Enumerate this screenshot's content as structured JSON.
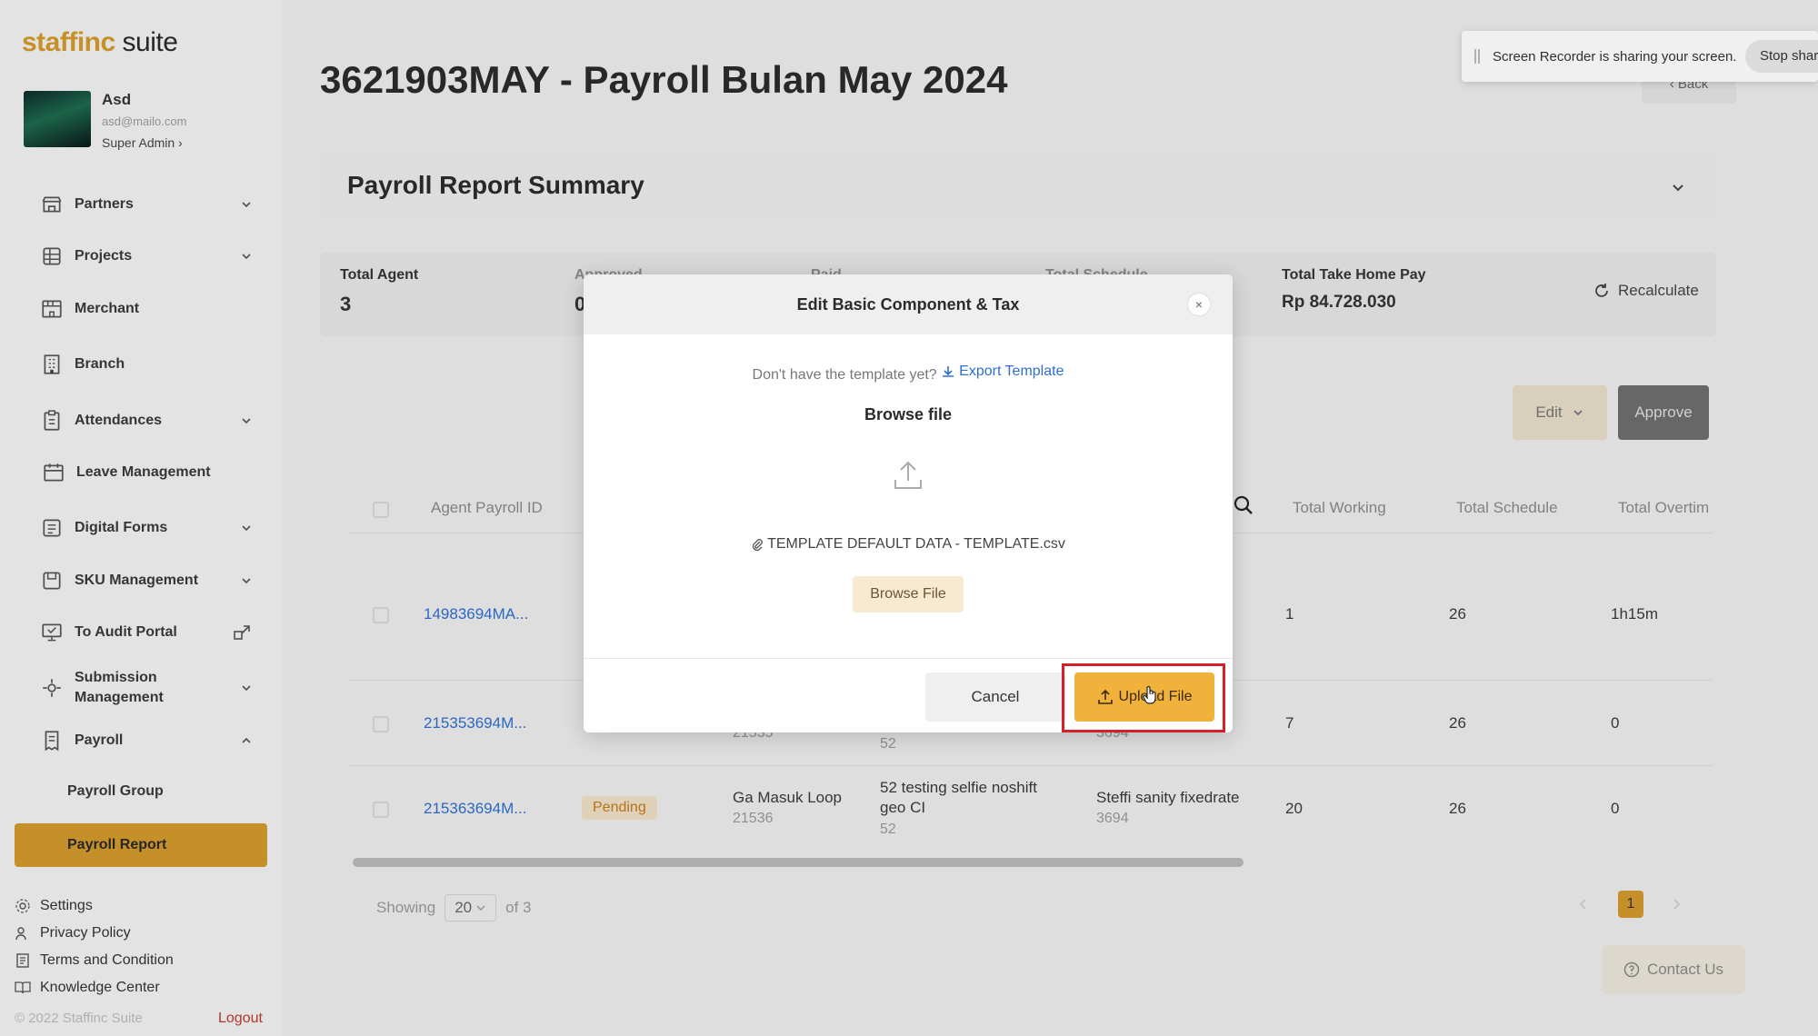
{
  "sidebar": {
    "logo_a": "staff",
    "logo_b": "inc",
    "logo_c": " suite",
    "user": {
      "name": "Asd",
      "email": "asd@mailo.com",
      "role": "Super Admin ›"
    },
    "items": [
      {
        "label": "Partners",
        "icon": "store-icon"
      },
      {
        "label": "Projects",
        "icon": "grid-icon"
      },
      {
        "label": "Merchant",
        "icon": "shop-icon"
      },
      {
        "label": "Branch",
        "icon": "building-icon"
      },
      {
        "label": "Attendances",
        "icon": "clipboard-icon"
      },
      {
        "label": "Leave Management",
        "icon": "calendar-icon"
      },
      {
        "label": "Digital Forms",
        "icon": "form-icon"
      },
      {
        "label": "SKU Management",
        "icon": "box-icon"
      },
      {
        "label": "To Audit Portal",
        "icon": "monitor-icon"
      },
      {
        "label": "Submission Management",
        "icon": "gear-icon"
      },
      {
        "label": "Payroll",
        "icon": "receipt-icon"
      }
    ],
    "payroll_sub": {
      "group": "Payroll Group",
      "report": "Payroll Report"
    },
    "footer": {
      "settings": "Settings",
      "privacy": "Privacy Policy",
      "terms": "Terms and Condition",
      "knowledge": "Knowledge Center",
      "copyright": "© 2022 Staffinc Suite",
      "logout": "Logout"
    }
  },
  "header": {
    "title": "3621903MAY - Payroll Bulan May 2024",
    "back": "‹ Back",
    "recorder_text": "Screen Recorder is sharing your screen.",
    "stop_share": "Stop sharing"
  },
  "summary": {
    "title": "Payroll Report Summary",
    "stats": [
      {
        "label": "Total Agent",
        "value": "3"
      },
      {
        "label": "Approved",
        "value": "0"
      },
      {
        "label": "Paid",
        "value": ""
      },
      {
        "label": "Total Schedule",
        "value": ""
      },
      {
        "label": "Total Take Home Pay",
        "value": "Rp 84.728.030"
      }
    ],
    "recalculate": "Recalculate",
    "edit": "Edit",
    "approve": "Approve"
  },
  "table": {
    "headers": [
      "Agent Payroll ID",
      "Total Working",
      "Total Schedule",
      "Total Overtim"
    ],
    "rows": [
      {
        "id": "14983694MA...",
        "working": "1",
        "schedule": "26",
        "overtime": "1h15m"
      },
      {
        "id": "215353694M...",
        "working": "7",
        "schedule": "26",
        "overtime": "0"
      },
      {
        "id": "215363694M...",
        "status": "Pending",
        "merchant": "Ga Masuk Loop",
        "merchant_id": "21536",
        "branch": "52 testing selfie noshift geo CI",
        "branch_id": "52",
        "agent": "Steffi sanity fixedrate",
        "agent_id": "3694",
        "working": "20",
        "schedule": "26",
        "overtime": "0"
      }
    ],
    "partial": {
      "row2_col3": "21535",
      "row2_col4": "52",
      "row2_col5": "3694"
    },
    "showing_label": "Showing",
    "per_page": "20",
    "of_label": "of 3",
    "current_page": "1"
  },
  "contact": "Contact Us",
  "modal": {
    "title": "Edit Basic Component & Tax",
    "close": "×",
    "hint": "Don't have the template yet?",
    "export": "Export Template",
    "browse_title": "Browse file",
    "file_name": "TEMPLATE DEFAULT DATA - TEMPLATE.csv",
    "browse_button": "Browse File",
    "cancel": "Cancel",
    "upload": "Upload File"
  },
  "colors": {
    "accent": "#d29a2d",
    "upload_button": "#f0b23a",
    "link": "#2f6fd0",
    "highlight": "#d62027"
  }
}
